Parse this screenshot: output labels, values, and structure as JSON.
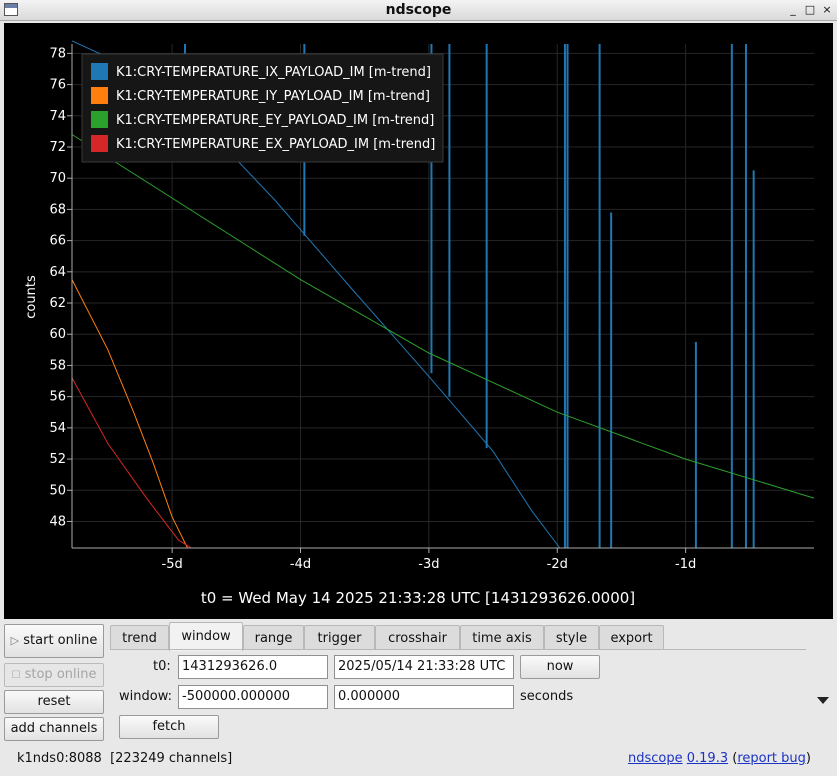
{
  "window": {
    "title": "ndscope",
    "controls": [
      "_",
      "□",
      "×"
    ]
  },
  "plot": {
    "title": "t0 = Wed May 14 2025 21:33:28 UTC [1431293626.0000]",
    "legend": [
      {
        "label": "K1:CRY-TEMPERATURE_IX_PAYLOAD_IM [m-trend]",
        "color": "#1f77b4"
      },
      {
        "label": "K1:CRY-TEMPERATURE_IY_PAYLOAD_IM [m-trend]",
        "color": "#ff7f0e"
      },
      {
        "label": "K1:CRY-TEMPERATURE_EY_PAYLOAD_IM [m-trend]",
        "color": "#2ca02c"
      },
      {
        "label": "K1:CRY-TEMPERATURE_EX_PAYLOAD_IM [m-trend]",
        "color": "#d62728"
      }
    ]
  },
  "chart_data": {
    "type": "line",
    "title": "t0 = Wed May 14 2025 21:33:28 UTC [1431293626.0000]",
    "xlabel": "",
    "ylabel": "counts",
    "x_unit": "day",
    "xlim": [
      -5.78,
      0.0
    ],
    "ylim": [
      46.3,
      78.6
    ],
    "x_ticks": [
      -5,
      -4,
      -3,
      -2,
      -1
    ],
    "x_tick_labels": [
      "-5d",
      "-4d",
      "-3d",
      "-2d",
      "-1d"
    ],
    "y_ticks": [
      48,
      50,
      52,
      54,
      56,
      58,
      60,
      62,
      64,
      66,
      68,
      70,
      72,
      74,
      76,
      78
    ],
    "grid": true,
    "legend_position": "top-left",
    "series": [
      {
        "name": "K1:CRY-TEMPERATURE_IX_PAYLOAD_IM [m-trend]",
        "color": "#1f77b4",
        "x": [
          -5.78,
          -5.3,
          -4.8,
          -4.2,
          -3.6,
          -3.0,
          -2.5,
          -2.2,
          -1.98
        ],
        "y": [
          78.8,
          77.0,
          73.8,
          68.6,
          62.9,
          57.3,
          52.5,
          48.7,
          46.3
        ],
        "spikes": [
          {
            "x": -4.9,
            "ymin": 73.3,
            "ymax": 78.6
          },
          {
            "x": -3.97,
            "ymin": 66.3,
            "ymax": 78.6
          },
          {
            "x": -2.98,
            "ymin": 57.5,
            "ymax": 78.6
          },
          {
            "x": -2.84,
            "ymin": 56.0,
            "ymax": 78.6
          },
          {
            "x": -2.55,
            "ymin": 52.7,
            "ymax": 78.6
          },
          {
            "x": -1.94,
            "ymin": 46.3,
            "ymax": 78.6
          },
          {
            "x": -1.92,
            "ymin": 46.3,
            "ymax": 78.6
          },
          {
            "x": -1.67,
            "ymin": 46.3,
            "ymax": 78.6
          },
          {
            "x": -1.58,
            "ymin": 46.3,
            "ymax": 67.8
          },
          {
            "x": -0.92,
            "ymin": 46.3,
            "ymax": 59.5
          },
          {
            "x": -0.64,
            "ymin": 46.3,
            "ymax": 78.6
          },
          {
            "x": -0.53,
            "ymin": 46.3,
            "ymax": 78.6
          },
          {
            "x": -0.47,
            "ymin": 46.3,
            "ymax": 70.5
          }
        ]
      },
      {
        "name": "K1:CRY-TEMPERATURE_IY_PAYLOAD_IM [m-trend]",
        "color": "#ff7f0e",
        "x": [
          -5.78,
          -5.5,
          -5.3,
          -5.15,
          -5.0,
          -4.88
        ],
        "y": [
          63.5,
          59.0,
          55.0,
          51.8,
          48.3,
          46.3
        ]
      },
      {
        "name": "K1:CRY-TEMPERATURE_EY_PAYLOAD_IM [m-trend]",
        "color": "#2ca02c",
        "x": [
          -5.78,
          -4.0,
          -3.0,
          -2.0,
          -1.0,
          0.0
        ],
        "y": [
          72.8,
          63.5,
          58.8,
          55.0,
          52.0,
          49.5
        ]
      },
      {
        "name": "K1:CRY-TEMPERATURE_EX_PAYLOAD_IM [m-trend]",
        "color": "#d62728",
        "x": [
          -5.78,
          -5.5,
          -5.2,
          -4.95,
          -4.85
        ],
        "y": [
          57.2,
          53.0,
          49.5,
          46.8,
          46.3
        ]
      }
    ]
  },
  "tabs": [
    {
      "label": "trend",
      "active": false
    },
    {
      "label": "window",
      "active": true
    },
    {
      "label": "range",
      "active": false
    },
    {
      "label": "trigger",
      "active": false
    },
    {
      "label": "crosshair",
      "active": false
    },
    {
      "label": "time axis",
      "active": false
    },
    {
      "label": "style",
      "active": false
    },
    {
      "label": "export",
      "active": false
    }
  ],
  "side_buttons": {
    "start_online": "start online",
    "stop_online": "stop online",
    "reset": "reset",
    "add_channels": "add channels"
  },
  "window_tab": {
    "t0_label": "t0:",
    "t0_gps": "1431293626.0",
    "t0_utc": "2025/05/14 21:33:28 UTC",
    "now_button": "now",
    "window_label": "window:",
    "window_start": "-500000.000000",
    "window_end": "0.000000",
    "seconds_label": "seconds",
    "fetch_button": "fetch"
  },
  "status": {
    "server": "k1nds0:8088",
    "channels": "[223249 channels]",
    "app_name": "ndscope",
    "version": "0.19.3",
    "open_paren": " (",
    "report_bug": "report bug",
    "close_paren": ")"
  }
}
